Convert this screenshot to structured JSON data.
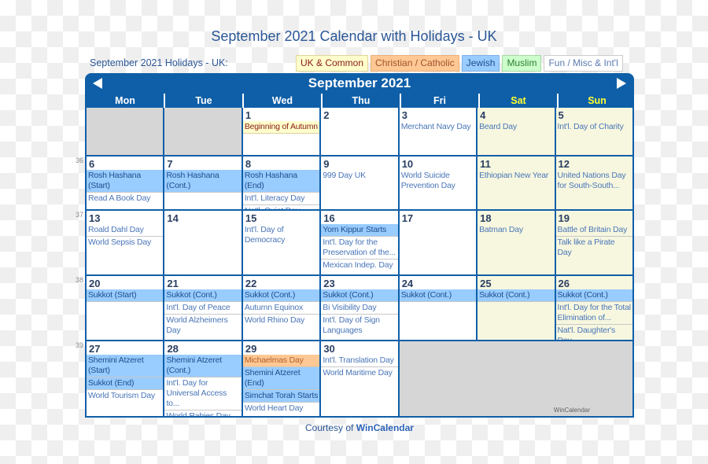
{
  "page": {
    "title": "September 2021 Calendar with Holidays - UK",
    "subtitle": "September 2021 Holidays - UK:",
    "courtesy_prefix": "Courtesy of ",
    "courtesy_brand": "WinCalendar",
    "watermark": "WinCalendar"
  },
  "legend": {
    "uk": "UK & Common",
    "christian": "Christian / Catholic",
    "jewish": "Jewish",
    "muslim": "Muslim",
    "fun": "Fun / Misc & Int'l"
  },
  "colors": {
    "header_blue": "#0f5fa8",
    "weekend_label": "#ffff33",
    "jewish_bg": "#99ccff",
    "uk_bg": "#ffffcc",
    "christian_bg": "#ffc894",
    "muslim_bg": "#ccffcc",
    "weekend_bg": "#f7f7df",
    "blank_bg": "#d6d6d6"
  },
  "calendar": {
    "month_label": "September 2021",
    "prev_icon": "triangle-left-icon",
    "next_icon": "triangle-right-icon",
    "days_of_week": [
      "Mon",
      "Tue",
      "Wed",
      "Thu",
      "Fri",
      "Sat",
      "Sun"
    ],
    "weeks": [
      {
        "week_number": "",
        "days": [
          {
            "blank": true
          },
          {
            "blank": true
          },
          {
            "day": "1",
            "events": [
              {
                "text": "Beginning of Autumn",
                "type": "uk"
              }
            ]
          },
          {
            "day": "2",
            "events": []
          },
          {
            "day": "3",
            "events": [
              {
                "text": "Merchant Navy Day",
                "type": "fun"
              }
            ]
          },
          {
            "day": "4",
            "weekend": true,
            "events": [
              {
                "text": "Beard Day",
                "type": "fun"
              }
            ]
          },
          {
            "day": "5",
            "weekend": true,
            "events": [
              {
                "text": "Int'l. Day of Charity",
                "type": "fun"
              }
            ]
          }
        ]
      },
      {
        "week_number": "36",
        "days": [
          {
            "day": "6",
            "events": [
              {
                "text": "Rosh Hashana (Start)",
                "type": "jewish"
              },
              {
                "text": "Read A Book Day",
                "type": "fun"
              }
            ]
          },
          {
            "day": "7",
            "events": [
              {
                "text": "Rosh Hashana (Cont.)",
                "type": "jewish"
              }
            ]
          },
          {
            "day": "8",
            "events": [
              {
                "text": "Rosh Hashana (End)",
                "type": "jewish"
              },
              {
                "text": "Int'l. Literacy Day",
                "type": "fun"
              },
              {
                "text": "Nat'l. Quiet Day",
                "type": "fun"
              }
            ]
          },
          {
            "day": "9",
            "events": [
              {
                "text": "999 Day UK",
                "type": "fun"
              }
            ]
          },
          {
            "day": "10",
            "events": [
              {
                "text": "World Suicide Prevention Day",
                "type": "fun"
              }
            ]
          },
          {
            "day": "11",
            "weekend": true,
            "events": [
              {
                "text": "Ethiopian New Year",
                "type": "fun"
              }
            ]
          },
          {
            "day": "12",
            "weekend": true,
            "events": [
              {
                "text": "United Nations Day for South-South...",
                "type": "fun"
              }
            ]
          }
        ]
      },
      {
        "week_number": "37",
        "days": [
          {
            "day": "13",
            "events": [
              {
                "text": "Roald Dahl Day",
                "type": "fun"
              },
              {
                "text": "World Sepsis Day",
                "type": "fun"
              }
            ]
          },
          {
            "day": "14",
            "events": []
          },
          {
            "day": "15",
            "events": [
              {
                "text": "Int'l. Day of Democracy",
                "type": "fun"
              }
            ]
          },
          {
            "day": "16",
            "events": [
              {
                "text": "Yom Kippur Starts",
                "type": "jewish"
              },
              {
                "text": "Int'l. Day for the Preservation of the...",
                "type": "fun"
              },
              {
                "text": "Mexican Indep. Day",
                "type": "fun"
              }
            ]
          },
          {
            "day": "17",
            "events": []
          },
          {
            "day": "18",
            "weekend": true,
            "events": [
              {
                "text": "Batman Day",
                "type": "fun"
              }
            ]
          },
          {
            "day": "19",
            "weekend": true,
            "events": [
              {
                "text": "Battle of Britain Day",
                "type": "fun"
              },
              {
                "text": "Talk like a Pirate Day",
                "type": "fun"
              }
            ]
          }
        ]
      },
      {
        "week_number": "38",
        "days": [
          {
            "day": "20",
            "events": [
              {
                "text": "Sukkot (Start)",
                "type": "jewish"
              }
            ]
          },
          {
            "day": "21",
            "events": [
              {
                "text": "Sukkot (Cont.)",
                "type": "jewish"
              },
              {
                "text": "Int'l. Day of Peace",
                "type": "fun"
              },
              {
                "text": "World Alzheimers Day",
                "type": "fun"
              }
            ]
          },
          {
            "day": "22",
            "events": [
              {
                "text": "Sukkot (Cont.)",
                "type": "jewish"
              },
              {
                "text": "Autumn Equinox",
                "type": "fun"
              },
              {
                "text": "World Rhino Day",
                "type": "fun"
              }
            ]
          },
          {
            "day": "23",
            "events": [
              {
                "text": "Sukkot (Cont.)",
                "type": "jewish"
              },
              {
                "text": "Bi Visibility Day",
                "type": "fun"
              },
              {
                "text": "Int'l. Day of Sign Languages",
                "type": "fun"
              }
            ]
          },
          {
            "day": "24",
            "events": [
              {
                "text": "Sukkot (Cont.)",
                "type": "jewish"
              }
            ]
          },
          {
            "day": "25",
            "weekend": true,
            "events": [
              {
                "text": "Sukkot (Cont.)",
                "type": "jewish"
              }
            ]
          },
          {
            "day": "26",
            "weekend": true,
            "events": [
              {
                "text": "Sukkot (Cont.)",
                "type": "jewish"
              },
              {
                "text": "Int'l. Day for the Total Elimination of...",
                "type": "fun"
              },
              {
                "text": "Nat'l. Daughter's Day",
                "type": "fun"
              }
            ]
          }
        ]
      },
      {
        "week_number": "39",
        "days": [
          {
            "day": "27",
            "events": [
              {
                "text": "Shemini Atzeret (Start)",
                "type": "jewish"
              },
              {
                "text": "Sukkot (End)",
                "type": "jewish"
              },
              {
                "text": "World Tourism Day",
                "type": "fun"
              }
            ]
          },
          {
            "day": "28",
            "events": [
              {
                "text": "Shemini Atzeret (Cont.)",
                "type": "jewish"
              },
              {
                "text": "Int'l. Day for Universal Access to...",
                "type": "fun"
              },
              {
                "text": "World Rabies Day",
                "type": "fun"
              }
            ]
          },
          {
            "day": "29",
            "events": [
              {
                "text": "Michaelmas Day",
                "type": "christian"
              },
              {
                "text": "Shemini Atzeret (End)",
                "type": "jewish"
              },
              {
                "text": "Simchat Torah Starts",
                "type": "jewish"
              },
              {
                "text": "World Heart Day",
                "type": "fun"
              }
            ]
          },
          {
            "day": "30",
            "events": [
              {
                "text": "Int'l. Translation Day",
                "type": "fun"
              },
              {
                "text": "World Maritime Day",
                "type": "fun"
              }
            ]
          },
          {
            "blank": true,
            "span": 3
          }
        ]
      }
    ]
  }
}
